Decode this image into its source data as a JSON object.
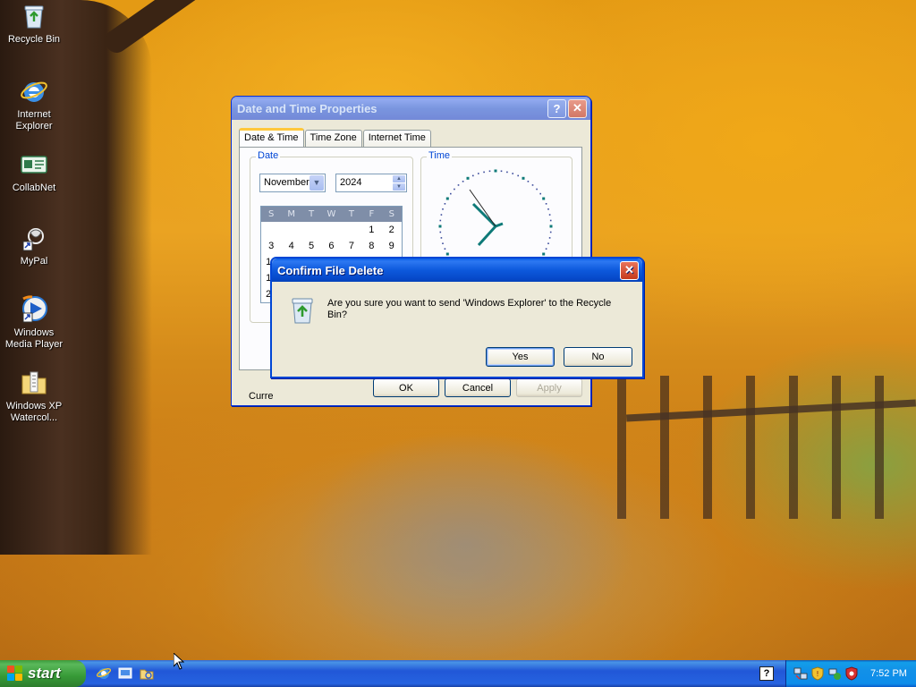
{
  "desktop": {
    "icons": [
      {
        "label": "Recycle Bin",
        "icon": "recycle-bin-icon"
      },
      {
        "label": "Internet Explorer",
        "icon": "internet-explorer-icon"
      },
      {
        "label": "CollabNet",
        "icon": "collabnet-icon"
      },
      {
        "label": "MyPal",
        "icon": "mypal-icon"
      },
      {
        "label": "Windows Media Player",
        "icon": "windows-media-player-icon"
      },
      {
        "label": "Windows XP Watercol...",
        "icon": "folder-icon"
      }
    ]
  },
  "date_time_window": {
    "title": "Date and Time Properties",
    "help_glyph": "?",
    "close_glyph": "✕",
    "tabs": [
      "Date & Time",
      "Time Zone",
      "Internet Time"
    ],
    "selected_tab": "Date & Time",
    "date_group": {
      "legend": "Date",
      "month": "November",
      "year": "2024",
      "weekdays": [
        "S",
        "M",
        "T",
        "W",
        "T",
        "F",
        "S"
      ],
      "rows": [
        [
          "",
          "",
          "",
          "",
          "",
          "1",
          "2"
        ],
        [
          "3",
          "4",
          "5",
          "6",
          "7",
          "8",
          "9"
        ],
        [
          "10",
          "",
          "",
          "",
          "",
          "",
          ""
        ],
        [
          "17",
          "",
          "",
          "",
          "",
          "",
          ""
        ],
        [
          "24",
          "",
          "",
          "",
          "",
          "",
          ""
        ]
      ],
      "visible_row_labels": [
        "1",
        "1",
        "2"
      ]
    },
    "time_group": {
      "legend": "Time"
    },
    "current_time_zone_label": "Curre",
    "buttons": {
      "ok": "OK",
      "cancel": "Cancel",
      "apply": "Apply"
    }
  },
  "confirm_dialog": {
    "title": "Confirm File Delete",
    "close_glyph": "✕",
    "message": "Are you sure you want to send 'Windows Explorer' to the Recycle Bin?",
    "buttons": {
      "yes": "Yes",
      "no": "No"
    }
  },
  "taskbar": {
    "start_label": "start",
    "quick_launch": [
      "internet-explorer-icon",
      "desktop-icon",
      "explorer-folder-icon"
    ],
    "help_glyph": "?",
    "tray_icons": [
      "network-icon",
      "security-shield-icon",
      "network-connection-icon",
      "antivirus-icon"
    ],
    "clock": "7:52 PM"
  },
  "colors": {
    "xp_blue": "#0a5fe6",
    "start_green": "#379a37",
    "dialog_face": "#ece9d8",
    "legend_blue": "#0046d5",
    "tab_highlight": "#ffc83c"
  }
}
